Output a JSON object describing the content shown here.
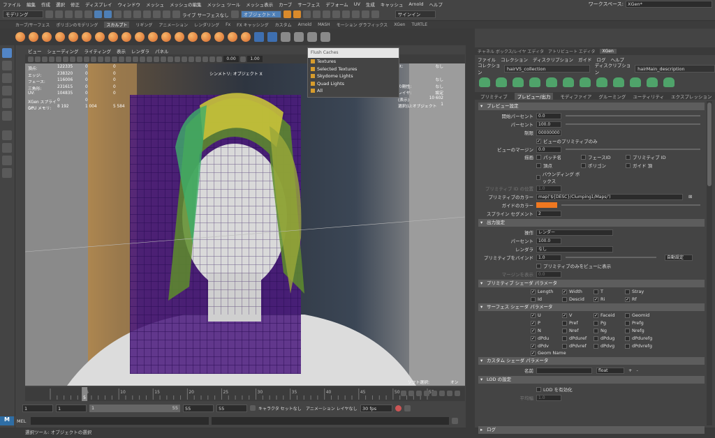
{
  "menubar": [
    "ファイル",
    "編集",
    "作成",
    "選択",
    "修正",
    "ディスプレイ",
    "ウィンドウ",
    "メッシュ",
    "メッシュの編集",
    "メッシュ ツール",
    "メッシュ表示",
    "カーブ",
    "サーフェス",
    "デフォーム",
    "UV",
    "生成",
    "キャッシュ",
    "Arnold",
    "ヘルプ"
  ],
  "workspace": {
    "label": "ワークスペース:",
    "value": "XGen*"
  },
  "status": {
    "mode": "モデリング",
    "live": "ライブ サーフェスなし",
    "search": "オブジェクト X",
    "signin": "サインイン"
  },
  "shelf_tabs": [
    "カーブ/サーフェス",
    "ポリゴンのモデリング",
    "スカルプト",
    "リギング",
    "アニメーション",
    "レンダリング",
    "Fx",
    "FX キャッシング",
    "カスタム",
    "Arnold",
    "MASH",
    "モーション グラフィックス",
    "XGen",
    "TURTLE"
  ],
  "shelf_active": "スカルプト",
  "viewport": {
    "menu": [
      "ビュー",
      "シェーディング",
      "ライティング",
      "表示",
      "レンダラ",
      "パネル"
    ],
    "near": "0.00",
    "far": "1.00",
    "camera_label": "シンメトリ: オブジェクト X",
    "hud": [
      [
        "頂点:",
        "122335",
        "0",
        "0"
      ],
      [
        "エッジ:",
        "238320",
        "0",
        "0"
      ],
      [
        "フェース:",
        "116006",
        "0",
        "0"
      ],
      [
        "三角形:",
        "231615",
        "0",
        "0"
      ],
      [
        "UV:",
        "104835",
        "0",
        "0"
      ],
      [
        "XGen スプライン:",
        "0",
        "0",
        ""
      ],
      [
        "GPU メモリ:",
        "8 192",
        "1 004",
        "5 584"
      ]
    ],
    "hud_right": [
      [
        "ス:",
        "なし"
      ],
      [
        "",
        ""
      ],
      [
        "",
        "なし"
      ],
      [
        "の剛性:",
        "なし"
      ],
      [
        "レイヤ:",
        "設定"
      ],
      [
        "(表示)",
        "10 602"
      ],
      [
        "選択(Ll:オブジェクト",
        "1"
      ]
    ],
    "bottom_right": "ソフト選択:",
    "bottom_right_val": "オン"
  },
  "flush": {
    "title": "Flush Caches",
    "items": [
      "Textures",
      "Selected Textures",
      "Skydome Lights",
      "Quad Lights",
      "All"
    ]
  },
  "timeline": {
    "ticks": [
      "5",
      "10",
      "15",
      "20",
      "25",
      "30",
      "35",
      "40",
      "45",
      "50",
      "55"
    ],
    "current": "5"
  },
  "range": {
    "start": "1",
    "start2": "1",
    "slider_start": "1",
    "slider_end": "55",
    "end": "55",
    "end2": "55",
    "char": "キャラクタ セットなし",
    "anim": "アニメーション レイヤなし",
    "fps": "30 fps"
  },
  "mel": "MEL",
  "helpline": "選択ツール: オブジェクトの選択",
  "right": {
    "tabs": [
      "チャネル ボックス/レイヤ エディタ",
      "アトリビュート エディタ",
      "XGen"
    ],
    "active_tab": "XGen",
    "menu": [
      "ファイル",
      "コレクション",
      "ディスクリプション",
      "ガイド",
      "ログ",
      "ヘルプ"
    ],
    "collection_label": "コレクション",
    "collection": "hairV5_collection",
    "description_label": "ディスクリプション",
    "description": "hairMain_description",
    "subtabs": [
      "プリミティブ",
      "プレビュー/出力",
      "モディファイア",
      "グルーミング",
      "ユーティリティ",
      "エクスプレッション"
    ],
    "active_subtab": "プレビュー/出力",
    "preview": {
      "title": "プレビュー設定",
      "start_percent_l": "開始パーセント",
      "start_percent": "0.0",
      "percent_l": "パーセント",
      "percent": "100.0",
      "limit_l": "制限",
      "limit": "00000000",
      "primitive_only": "ビューのプリミティブのみ",
      "margin_l": "ビューのマージン",
      "margin": "0.0",
      "draw_l": "描画",
      "draw_opts": [
        [
          "パッチ名",
          false
        ],
        [
          "フェースID",
          false
        ],
        [
          "プリミティブ ID",
          false
        ],
        [
          "頂点",
          false
        ],
        [
          "ポリゴン",
          false
        ],
        [
          "ガイド 頂",
          false
        ],
        [
          "バウンディング ボックス",
          false
        ]
      ],
      "prim_id_pos_l": "プリミティブ ID の位置",
      "prim_id_pos": "1.0",
      "prim_color_l": "プリミティブのカラー",
      "prim_color": "map('${DESC}/Clumping1/Maps/')",
      "guide_color_l": "ガイドのカラー",
      "guide_color": "#f07820",
      "spline_seg_l": "スプライン セグメント",
      "spline_seg": "2"
    },
    "output": {
      "title": "出力設定",
      "op_l": "操作",
      "op": "レンダー",
      "percent_l": "パーセント",
      "percent": "100.0",
      "renderer_l": "レンダラ",
      "renderer": "なし",
      "bind_l": "プリミティブをバインド",
      "bind": "1.0",
      "auto": "自動設定",
      "view_only": "プリミティブのみをビューに表示",
      "margin_l": "マージンを表示",
      "margin": "0.0"
    },
    "prim_shader": {
      "title": "プリミティブ シェーダ パラメータ",
      "opts": [
        [
          "Length",
          true
        ],
        [
          "Width",
          true
        ],
        [
          "T",
          false
        ],
        [
          "Stray",
          false
        ],
        [
          "Id",
          false
        ],
        [
          "Descid",
          false
        ],
        [
          "Ri",
          true
        ],
        [
          "Rf",
          true
        ]
      ]
    },
    "surf_shader": {
      "title": "サーフェス シェーダ パラメータ",
      "opts": [
        [
          "U",
          true
        ],
        [
          "V",
          true
        ],
        [
          "Faceid",
          true
        ],
        [
          "Geomid",
          false
        ],
        [
          "P",
          true
        ],
        [
          "Pref",
          false
        ],
        [
          "Pg",
          false
        ],
        [
          "Prefg",
          false
        ],
        [
          "N",
          true
        ],
        [
          "Nref",
          false
        ],
        [
          "Ng",
          false
        ],
        [
          "Nrefg",
          false
        ],
        [
          "dPdu",
          true
        ],
        [
          "dPduref",
          false
        ],
        [
          "dPdug",
          false
        ],
        [
          "dPdurefg",
          false
        ],
        [
          "dPdv",
          true
        ],
        [
          "dPdvref",
          false
        ],
        [
          "dPdvg",
          false
        ],
        [
          "dPdvrefg",
          false
        ]
      ],
      "geom_name": "Geom Name"
    },
    "custom": {
      "title": "カスタム シェーダ パラメータ",
      "name_l": "名前",
      "type": "float",
      "plus": "+",
      "minus": "-"
    },
    "lod": {
      "title": "LOD の設定",
      "enable": "LOD を有効化",
      "avg_l": "平均幅",
      "avg": "1.0"
    },
    "log": "ログ"
  }
}
